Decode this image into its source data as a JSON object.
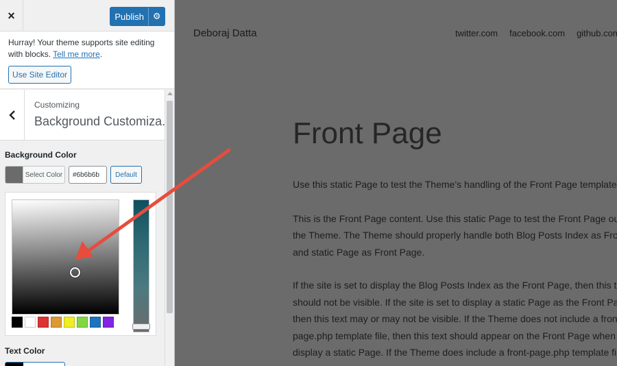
{
  "topbar": {
    "close_icon": "×",
    "publish_label": "Publish",
    "gear_icon": "⚙"
  },
  "notice": {
    "text": "Hurray! Your theme supports site editing with blocks.",
    "link": "Tell me more",
    "button": "Use Site Editor"
  },
  "section": {
    "customizing_label": "Customizing",
    "title": "Background Customiza..."
  },
  "background_color": {
    "label": "Background Color",
    "select_label": "Select Color",
    "hex_value": "#6b6b6b",
    "default_label": "Default",
    "current_color": "#6b6b6b",
    "palette": [
      "#000000",
      "#ffffff",
      "#dd3333",
      "#dd9933",
      "#eeee22",
      "#81d742",
      "#1e73be",
      "#8224e3"
    ]
  },
  "text_color": {
    "label": "Text Color"
  },
  "preview": {
    "site_title": "Deboraj Datta",
    "social_links": [
      "twitter.com",
      "facebook.com",
      "github.com"
    ],
    "page_title": "Front Page",
    "lines": [
      "Use this static Page to test the Theme’s handling of the Front Page template file.",
      "This is the Front Page content. Use this static Page to test the Front Page output of",
      "the Theme. The Theme should properly handle both Blog Posts Index as Front Page",
      "and static Page as Front Page.",
      "If the site is set to display the Blog Posts Index as the Front Page, then this text",
      "should not be visible. If the site is set to display a static Page as the Front Page,",
      "then this text may or may not be visible. If the Theme does not include a front-",
      "page.php template file, then this text should appear on the Front Page when set to",
      "display a static Page. If the Theme does include a front-page.php template file, then"
    ]
  },
  "colors": {
    "accent": "#2271b1",
    "arrow": "#e74c3c",
    "preview_bg": "#6b6b6b"
  }
}
